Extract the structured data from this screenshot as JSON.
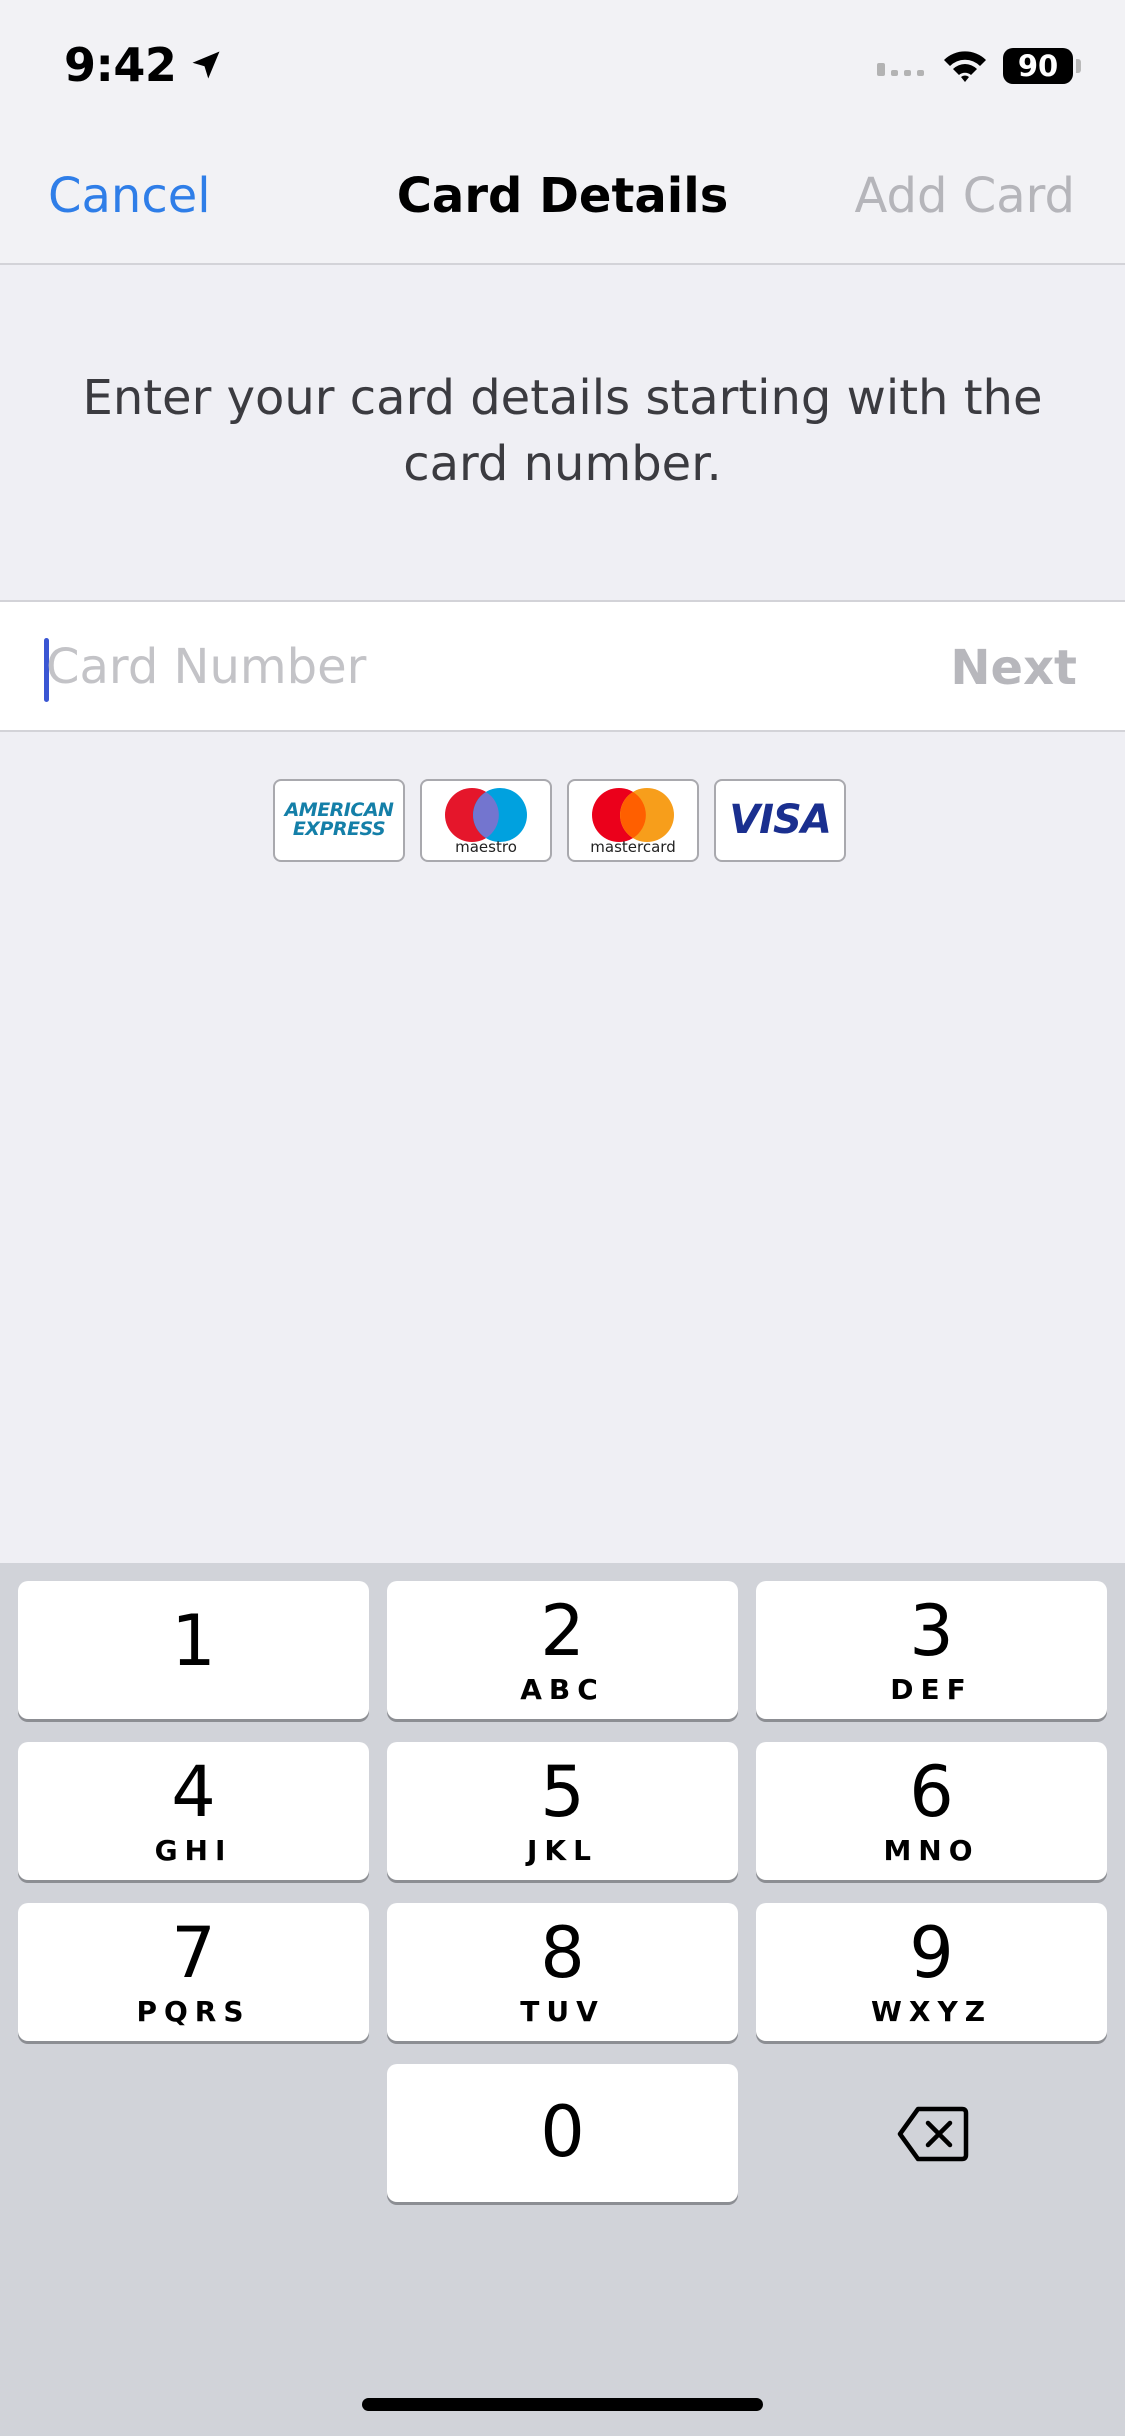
{
  "status_bar": {
    "time": "9:42",
    "battery": "90"
  },
  "nav": {
    "cancel_label": "Cancel",
    "title": "Card Details",
    "add_label": "Add Card"
  },
  "instruction": "Enter your card details starting with the card number.",
  "card_field": {
    "placeholder": "Card Number",
    "value": "",
    "next_label": "Next"
  },
  "card_logos": {
    "amex_line1": "AMERICAN",
    "amex_line2": "EXPRESS",
    "maestro": "maestro",
    "mastercard": "mastercard",
    "visa": "VISA"
  },
  "keypad": {
    "keys": [
      {
        "digit": "1",
        "letters": ""
      },
      {
        "digit": "2",
        "letters": "ABC"
      },
      {
        "digit": "3",
        "letters": "DEF"
      },
      {
        "digit": "4",
        "letters": "GHI"
      },
      {
        "digit": "5",
        "letters": "JKL"
      },
      {
        "digit": "6",
        "letters": "MNO"
      },
      {
        "digit": "7",
        "letters": "PQRS"
      },
      {
        "digit": "8",
        "letters": "TUV"
      },
      {
        "digit": "9",
        "letters": "WXYZ"
      },
      {
        "digit": "0",
        "letters": ""
      }
    ]
  },
  "colors": {
    "accent": "#2f7ee8",
    "disabled": "#b5b5ba",
    "background": "#efeff4",
    "keyboard": "#d1d3d9",
    "caret": "#3a56d3"
  },
  "icons": {
    "location": "location-arrow-icon",
    "signal": "cellular-signal-icon",
    "wifi": "wifi-icon",
    "delete": "delete-backspace-icon"
  }
}
